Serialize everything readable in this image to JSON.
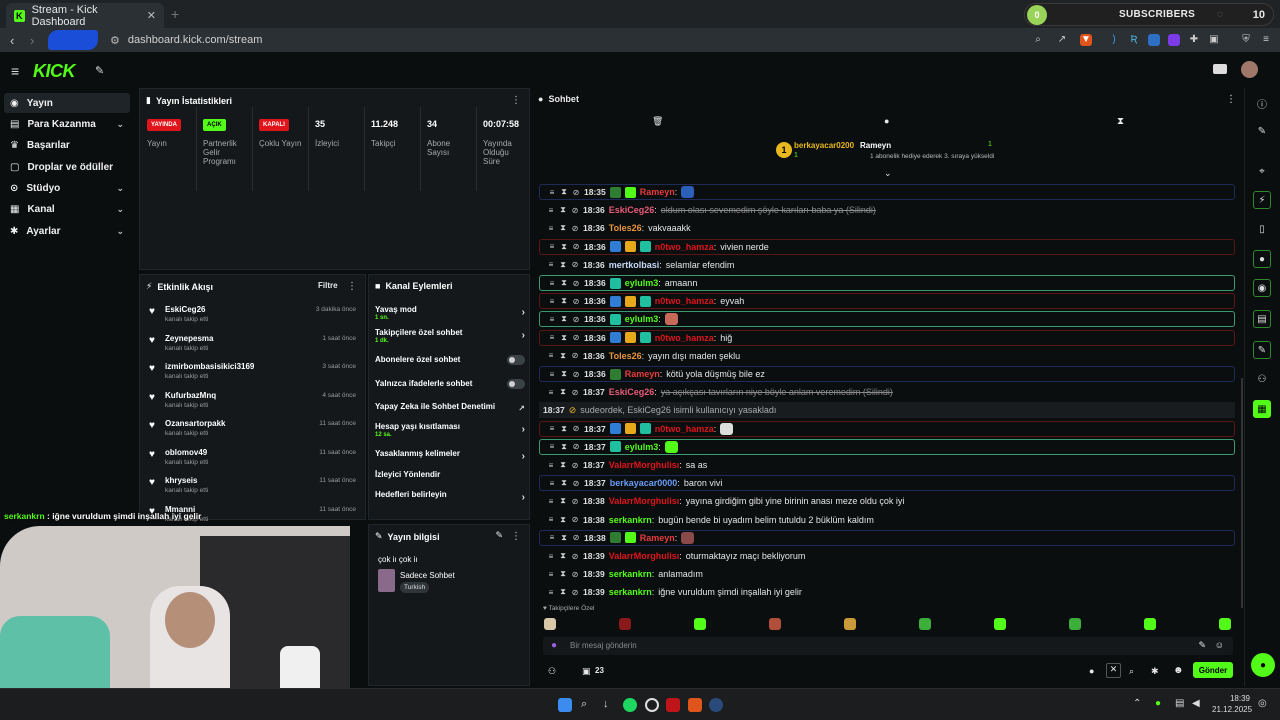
{
  "browser": {
    "tab_title": "Stream - Kick Dashboard",
    "url": "dashboard.kick.com/stream",
    "overlay": {
      "label": "SUBSCRIBERS",
      "ring_value": "0",
      "count": "10"
    }
  },
  "sidebar": {
    "items": [
      {
        "label": "Yayın",
        "icon": "broadcast-icon",
        "chevron": false
      },
      {
        "label": "Para Kazanma",
        "icon": "dollar-icon",
        "chevron": true
      },
      {
        "label": "Başarılar",
        "icon": "trophy-icon",
        "chevron": false
      },
      {
        "label": "Droplar ve ödüller",
        "icon": "gift-icon",
        "chevron": false
      },
      {
        "label": "Stüdyo",
        "icon": "studio-icon",
        "chevron": true
      },
      {
        "label": "Kanal",
        "icon": "channel-icon",
        "chevron": true
      },
      {
        "label": "Ayarlar",
        "icon": "gear-icon",
        "chevron": true
      }
    ]
  },
  "stats": {
    "title": "Yayın İstatistikleri",
    "cells": [
      {
        "badge": "YAYINDA",
        "badge_color": "#e0151b",
        "label": "Yayın"
      },
      {
        "badge": "AÇIK",
        "badge_color": "#53fc18",
        "label": "Partnerlik Gelir Programı"
      },
      {
        "badge": "KAPALI",
        "badge_color": "#e0151b",
        "label": "Çoklu Yayın"
      },
      {
        "value": "35",
        "label": "İzleyici"
      },
      {
        "value": "11.248",
        "label": "Takipçi"
      },
      {
        "value": "34",
        "label": "Abone Sayısı"
      },
      {
        "value": "00:07:58",
        "label": "Yayında Olduğu Süre"
      }
    ]
  },
  "activity": {
    "title": "Etkinlik Akışı",
    "filter": "Filtre",
    "events": [
      {
        "name": "EskiCeg26",
        "sub": "kanalı takip etti",
        "time": "3 dakika önce"
      },
      {
        "name": "Zeynepesma",
        "sub": "kanalı takip etti",
        "time": "1 saat önce"
      },
      {
        "name": "izmirbombasisikici3169",
        "sub": "kanalı takip etti",
        "time": "3 saat önce"
      },
      {
        "name": "KufurbazMnq",
        "sub": "kanalı takip etti",
        "time": "4 saat önce"
      },
      {
        "name": "Ozansartorpakk",
        "sub": "kanalı takip etti",
        "time": "11 saat önce"
      },
      {
        "name": "oblomov49",
        "sub": "kanalı takip etti",
        "time": "11 saat önce"
      },
      {
        "name": "khryseis",
        "sub": "kanalı takip etti",
        "time": "11 saat önce"
      },
      {
        "name": "Mmanni",
        "sub": "kanalı takip etti",
        "time": "11 saat önce"
      }
    ]
  },
  "actions": {
    "title": "Kanal Eylemleri",
    "items": [
      {
        "label": "Yavaş mod",
        "sub": "1 sn.",
        "control": "arrow"
      },
      {
        "label": "Takipçilere özel sohbet",
        "sub": "1 dk.",
        "control": "arrow"
      },
      {
        "label": "Abonelere özel sohbet",
        "sub": "",
        "control": "toggle"
      },
      {
        "label": "Yalnızca ifadelerle sohbet",
        "sub": "",
        "control": "toggle"
      },
      {
        "label": "Yapay Zeka ile Sohbet Denetimi",
        "sub": "",
        "control": "external"
      },
      {
        "label": "Hesap yaşı kısıtlaması",
        "sub": "12 sa.",
        "control": "arrow"
      },
      {
        "label": "Yasaklanmış kelimeler",
        "sub": "",
        "control": "arrow"
      },
      {
        "label": "İzleyici Yönlendir",
        "sub": "",
        "control": "none"
      },
      {
        "label": "Hedefleri belirleyin",
        "sub": "",
        "control": "arrow"
      }
    ]
  },
  "stream_info": {
    "title": "Yayın bilgisi",
    "stream_title": "çok iı çok iı",
    "category": "Sadece Sohbet",
    "language": "Turkish"
  },
  "overlay_chat": "serkankrn : iğne vuruldum şimdi inşallah iyi gelir",
  "chat": {
    "title": "Sohbet",
    "pinned": {
      "rank": "1",
      "user1": "berkayacar0200",
      "user1_count": "1",
      "user2": "Rameyn",
      "user2_count": "1",
      "user2_note": "1 abonelik hediye ederek 3. sıraya yükseldi"
    },
    "messages": [
      {
        "time": "18:35",
        "user": "Rameyn",
        "color": "#e83c3c",
        "text": "",
        "emote": "#2b5fb8",
        "hl": "hlb",
        "badges": [
          "#2f7d32",
          "#53fc18"
        ]
      },
      {
        "time": "18:36",
        "user": "EskiCeg26",
        "color": "#e85c7a",
        "text": "oldum olası sevemedim şöyle karıları baba ya (Silindi)",
        "del": true,
        "badges": []
      },
      {
        "time": "18:36",
        "user": "Toles26",
        "color": "#e8963c",
        "text": "vakvaaakk",
        "badges": []
      },
      {
        "time": "18:36",
        "user": "n0two_hamza",
        "color": "#e0151b",
        "text": "vivien nerde",
        "hl": "hl",
        "badges": [
          "#2f7dd4",
          "#e8a81c",
          "#1fbfa0"
        ]
      },
      {
        "time": "18:36",
        "user": "mertkolbasi",
        "color": "#c8d8f8",
        "text": "selamlar efendim",
        "badges": []
      },
      {
        "time": "18:36",
        "user": "eylulm3",
        "color": "#53fc18",
        "text": "amaann",
        "hl": "hlg",
        "badges": [
          "#1fbfa0"
        ]
      },
      {
        "time": "18:36",
        "user": "n0two_hamza",
        "color": "#e0151b",
        "text": "eyvah",
        "hl": "hl",
        "badges": [
          "#2f7dd4",
          "#e8a81c",
          "#1fbfa0"
        ]
      },
      {
        "time": "18:36",
        "user": "eylulm3",
        "color": "#53fc18",
        "text": "",
        "emote": "#c86a5a",
        "hl": "hlg",
        "badges": [
          "#1fbfa0"
        ]
      },
      {
        "time": "18:36",
        "user": "n0two_hamza",
        "color": "#e0151b",
        "text": "hiğ",
        "hl": "hl",
        "badges": [
          "#2f7dd4",
          "#e8a81c",
          "#1fbfa0"
        ]
      },
      {
        "time": "18:36",
        "user": "Toles26",
        "color": "#e8963c",
        "text": "yayın dışı maden şeklu",
        "badges": []
      },
      {
        "time": "18:36",
        "user": "Rameyn",
        "color": "#e83c3c",
        "text": "kötü yola düşmüş bile ez",
        "hl": "hlb",
        "badges": [
          "#2f7d32"
        ]
      },
      {
        "time": "18:37",
        "user": "EskiCeg26",
        "color": "#e85c7a",
        "text": "ya açıkçası tavırların niye böyle anlam veremedim (Silindi)",
        "del": true,
        "badges": []
      },
      {
        "system": true,
        "time": "18:37",
        "text": "sudeordek, EskiCeg26 isimli kullanıcıyı yasakladı"
      },
      {
        "time": "18:37",
        "user": "n0two_hamza",
        "color": "#e0151b",
        "text": "",
        "emote": "#dddddd",
        "hl": "hl",
        "badges": [
          "#2f7dd4",
          "#e8a81c",
          "#1fbfa0"
        ]
      },
      {
        "time": "18:37",
        "user": "eylulm3",
        "color": "#53fc18",
        "text": "",
        "emote": "#53fc18",
        "hl": "hlg",
        "badges": [
          "#1fbfa0"
        ]
      },
      {
        "time": "18:37",
        "user": "ValarrMorghulisı",
        "color": "#e0151b",
        "text": "sa as",
        "badges": []
      },
      {
        "time": "18:37",
        "user": "berkayacar0000",
        "color": "#6a9cf8",
        "text": "baron vivi",
        "hl": "hlb",
        "badges": []
      },
      {
        "time": "18:38",
        "user": "ValarrMorghulisı",
        "color": "#e0151b",
        "text": "yayına girdiğim gibi yine birinin anası meze oldu çok iyi",
        "badges": []
      },
      {
        "time": "18:38",
        "user": "serkankrn",
        "color": "#53fc18",
        "text": "bugün bende bi uyadım belim tutuldu 2 büklüm kaldım",
        "badges": []
      },
      {
        "time": "18:38",
        "user": "Rameyn",
        "color": "#e83c3c",
        "text": "",
        "emote": "#8a4a4a",
        "hl": "hlb",
        "badges": [
          "#2f7d32",
          "#53fc18"
        ]
      },
      {
        "time": "18:39",
        "user": "ValarrMorghulisı",
        "color": "#e0151b",
        "text": "oturmaktayız maçı bekliyorum",
        "badges": []
      },
      {
        "time": "18:39",
        "user": "serkankrn",
        "color": "#53fc18",
        "text": "anlamadım",
        "badges": []
      },
      {
        "time": "18:39",
        "user": "serkankrn",
        "color": "#53fc18",
        "text": "iğne vuruldum şimdi inşallah iyi gelir",
        "badges": []
      }
    ],
    "emote_bar_label": "Takipçilere Özel",
    "input_placeholder": "Bir mesaj gönderin",
    "viewer_count": "23",
    "send_label": "Gönder"
  },
  "clock": {
    "time": "18:39",
    "date": "21.12.2025"
  },
  "colors": {
    "accent": "#53fc18",
    "panel": "#14181b",
    "bg": "#0b0e0f"
  }
}
